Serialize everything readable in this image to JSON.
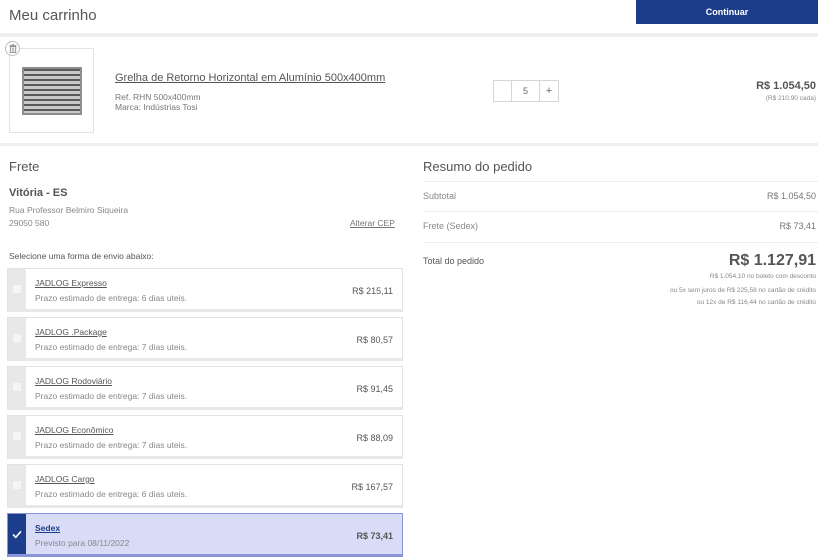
{
  "header": {
    "title": "Meu carrinho",
    "continue_label": "Continuar"
  },
  "cart": {
    "items": [
      {
        "name": "Grelha de Retorno Horizontal em Alumínio 500x400mm",
        "ref": "Ref. RHN 500x400mm",
        "brand": "Marca: Indústrias Tosi",
        "quantity": "5",
        "plus_label": "+",
        "total": "R$ 1.054,50",
        "unit_price": "(R$ 210,90 cada)"
      }
    ]
  },
  "shipping": {
    "title": "Frete",
    "city": "Vitória - ES",
    "street": "Rua Professor Belmiro Siqueira",
    "cep": "29050 580",
    "change_cep_label": "Alterar CEP",
    "select_label": "Selecione uma forma de envio abaixo:",
    "options": [
      {
        "name": "JADLOG Expresso",
        "eta": "Prazo estimado de entrega: 6 dias uteis.",
        "price": "R$ 215,11",
        "selected": false
      },
      {
        "name": "JADLOG .Package",
        "eta": "Prazo estimado de entrega: 7 dias uteis.",
        "price": "R$ 80,57",
        "selected": false
      },
      {
        "name": "JADLOG Rodoviário",
        "eta": "Prazo estimado de entrega: 7 dias uteis.",
        "price": "R$ 91,45",
        "selected": false
      },
      {
        "name": "JADLOG Econômico",
        "eta": "Prazo estimado de entrega: 7 dias uteis.",
        "price": "R$ 88,09",
        "selected": false
      },
      {
        "name": "JADLOG Cargo",
        "eta": "Prazo estimado de entrega: 6 dias uteis.",
        "price": "R$ 167,57",
        "selected": false
      },
      {
        "name": "Sedex",
        "eta": "Previsto para 08/11/2022",
        "price": "R$ 73,41",
        "selected": true
      }
    ]
  },
  "summary": {
    "title": "Resumo do pedido",
    "subtotal_label": "Subtotal",
    "subtotal_value": "R$ 1.054,50",
    "freight_label": "Frete (Sedex)",
    "freight_value": "R$ 73,41",
    "total_label": "Total do pedido",
    "total_value": "R$ 1.127,91",
    "note_boleto": "R$ 1.054,10 no boleto com desconto",
    "note_5x": "ou 5x sem juros de R$ 225,58 no cartão de crédito",
    "note_12x": "ou 12x de R$ 116,44 no cartão de crédito"
  },
  "colors": {
    "accent": "#1c3d8a",
    "selected_bg": "#d8dcf7"
  }
}
